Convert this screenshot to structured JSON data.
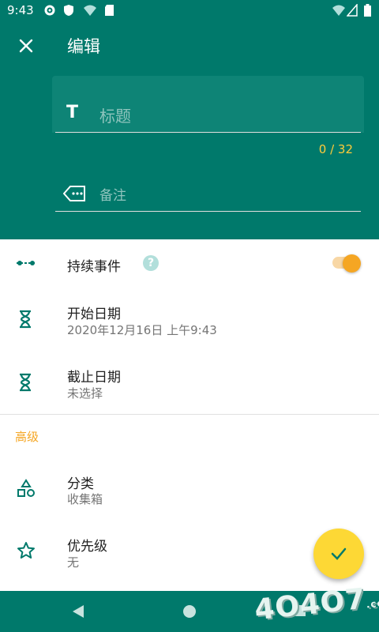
{
  "status_bar": {
    "time": "9:43"
  },
  "header": {
    "title": "编辑",
    "title_field": {
      "icon_text": "T",
      "placeholder": "标题",
      "counter": "0 / 32"
    },
    "note_field": {
      "placeholder": "备注"
    }
  },
  "rows": {
    "continuous": {
      "label": "持续事件",
      "help": "?",
      "toggle_on": true
    },
    "start": {
      "label": "开始日期",
      "value": "2020年12月16日 上午9:43"
    },
    "end": {
      "label": "截止日期",
      "value": "未选择"
    }
  },
  "advanced": {
    "section_label": "高级",
    "category": {
      "label": "分类",
      "value": "收集箱"
    },
    "priority": {
      "label": "优先级",
      "value": "无"
    }
  },
  "watermark": {
    "text": "4O4O7",
    "suffix": ".com"
  },
  "colors": {
    "primary": "#00796b",
    "accent": "#f5a623",
    "fab": "#fdd835",
    "counter": "#ffcb3a"
  }
}
